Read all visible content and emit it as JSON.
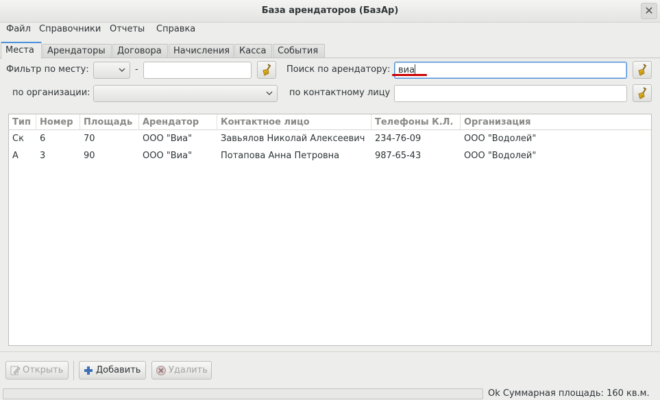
{
  "window": {
    "title": "База арендаторов (БазАр)"
  },
  "menu": {
    "items": [
      "Файл",
      "Справочники",
      "Отчеты",
      "Справка"
    ]
  },
  "tabs": [
    "Места",
    "Арендаторы",
    "Договора",
    "Начисления",
    "Касса",
    "События"
  ],
  "active_tab": "Места",
  "filters": {
    "place_label": "Фильтр по месту:",
    "place_dash": "-",
    "place_value": "",
    "org_label": "по организации:",
    "tenant_search_label": "Поиск по арендатору:",
    "tenant_search_value": "виа",
    "contact_label": "по контактному лицу",
    "contact_value": ""
  },
  "table": {
    "columns": [
      "Тип",
      "Номер",
      "Площадь",
      "Арендатор",
      "Контактное лицо",
      "Телефоны К.Л.",
      "Организация"
    ],
    "rows": [
      [
        "Ск",
        "6",
        "70",
        "ООО \"Виа\"",
        "Завьялов Николай Алексеевич",
        "234-76-09",
        "ООО \"Водолей\""
      ],
      [
        "А",
        "3",
        "90",
        "ООО \"Виа\"",
        "Потапова Анна Петровна",
        "987-65-43",
        "ООО \"Водолей\""
      ]
    ]
  },
  "toolbar": {
    "open_label": "Открыть",
    "add_label": "Добавить",
    "delete_label": "Удалить"
  },
  "status": {
    "ok": "Ok",
    "summary": "Суммарная площадь: 160 кв.м."
  },
  "colors": {
    "focus": "#4a90d9",
    "spell_error": "#cc0000",
    "broom": "#e0b020"
  }
}
